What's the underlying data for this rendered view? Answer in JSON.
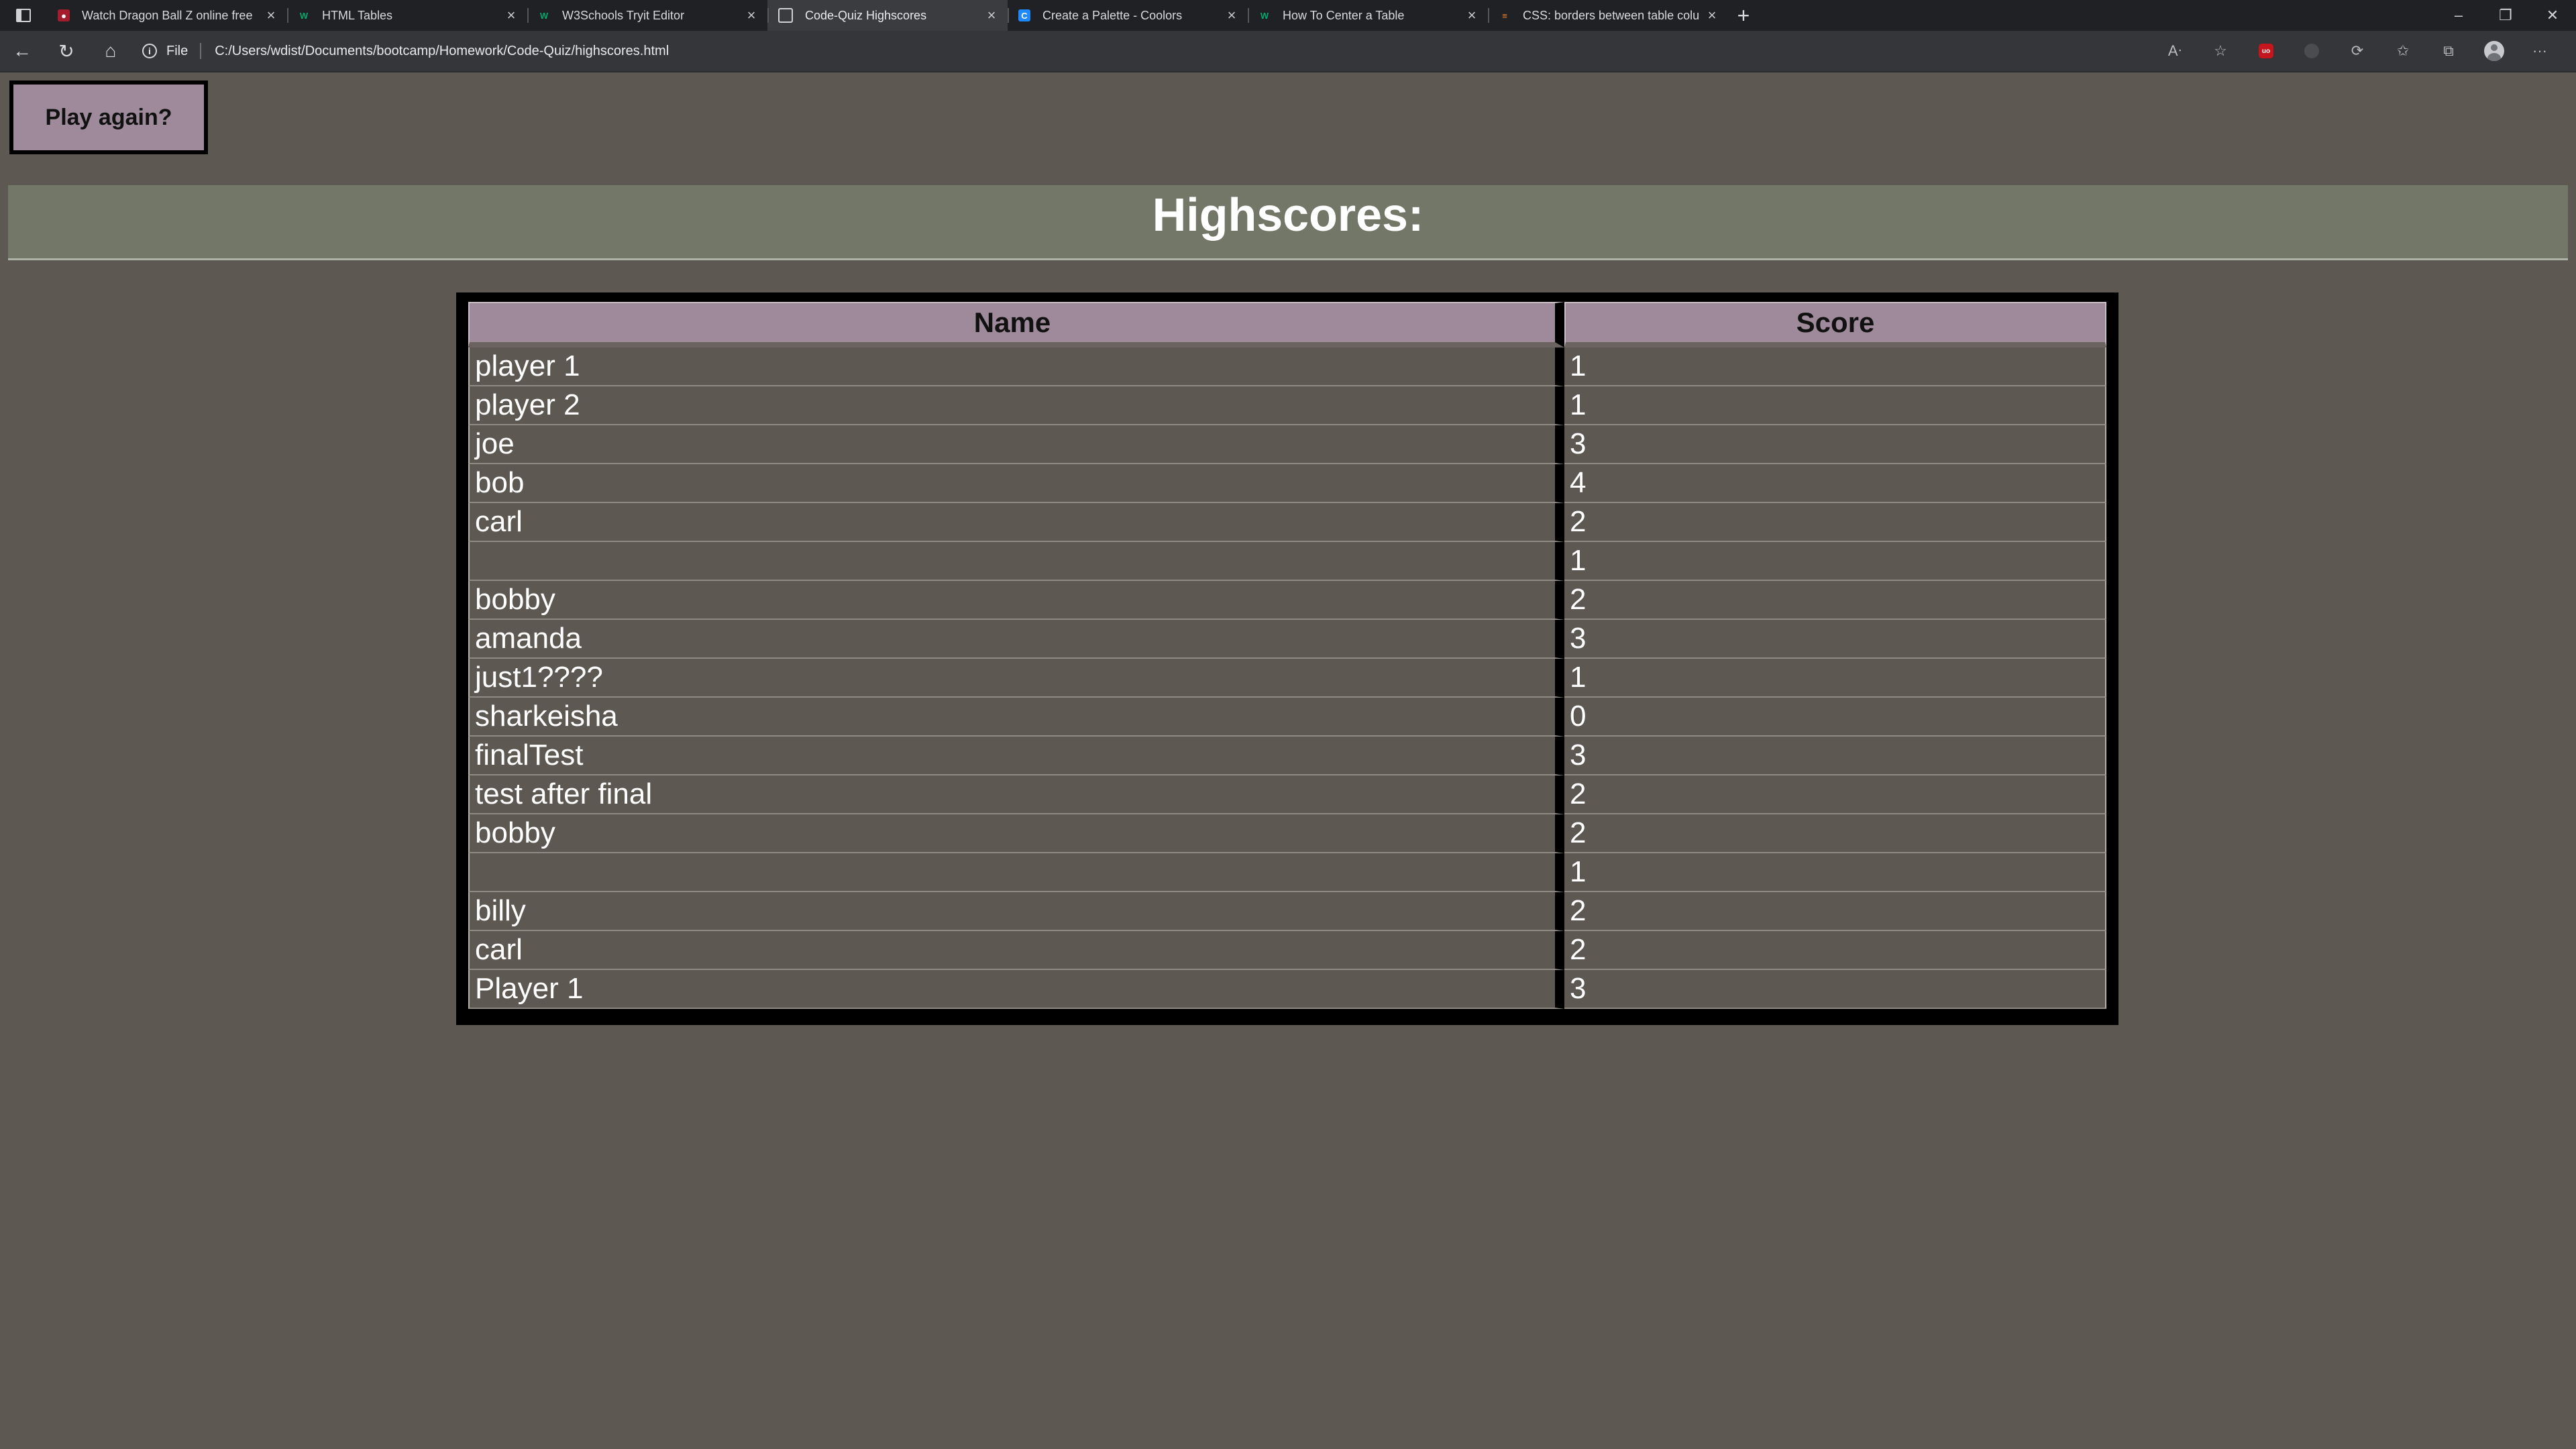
{
  "browser": {
    "tabs": [
      {
        "title": "Watch Dragon Ball Z online free",
        "icon": "dragonball-favicon",
        "active": false
      },
      {
        "title": "HTML Tables",
        "icon": "w3schools-favicon",
        "active": false
      },
      {
        "title": "W3Schools Tryit Editor",
        "icon": "w3schools-favicon",
        "active": false
      },
      {
        "title": "Code-Quiz Highscores",
        "icon": "document-favicon",
        "active": true
      },
      {
        "title": "Create a Palette - Coolors",
        "icon": "coolors-favicon",
        "active": false
      },
      {
        "title": "How To Center a Table",
        "icon": "w3schools-favicon",
        "active": false
      },
      {
        "title": "CSS: borders between table colu",
        "icon": "stackoverflow-favicon",
        "active": false
      }
    ],
    "address": {
      "scheme_label": "File",
      "url": "C:/Users/wdist/Documents/bootcamp/Homework/Code-Quiz/highscores.html"
    }
  },
  "page": {
    "play_again_label": "Play again?",
    "heading": "Highscores:",
    "table": {
      "headers": [
        "Name",
        "Score"
      ],
      "rows": [
        {
          "name": "player 1",
          "score": "1"
        },
        {
          "name": "player 2",
          "score": "1"
        },
        {
          "name": "joe",
          "score": "3"
        },
        {
          "name": "bob",
          "score": "4"
        },
        {
          "name": "carl",
          "score": "2"
        },
        {
          "name": "",
          "score": "1"
        },
        {
          "name": "bobby",
          "score": "2"
        },
        {
          "name": "amanda",
          "score": "3"
        },
        {
          "name": "just1????",
          "score": "1"
        },
        {
          "name": "sharkeisha",
          "score": "0"
        },
        {
          "name": "finalTest",
          "score": "3"
        },
        {
          "name": "test after final",
          "score": "2"
        },
        {
          "name": "bobby",
          "score": "2"
        },
        {
          "name": "",
          "score": "1"
        },
        {
          "name": "billy",
          "score": "2"
        },
        {
          "name": "carl",
          "score": "2"
        },
        {
          "name": "Player 1",
          "score": "3"
        }
      ]
    }
  },
  "colors": {
    "page_background": "#5d5851",
    "button_background": "#9f8a9b",
    "header_band": "#737768"
  }
}
